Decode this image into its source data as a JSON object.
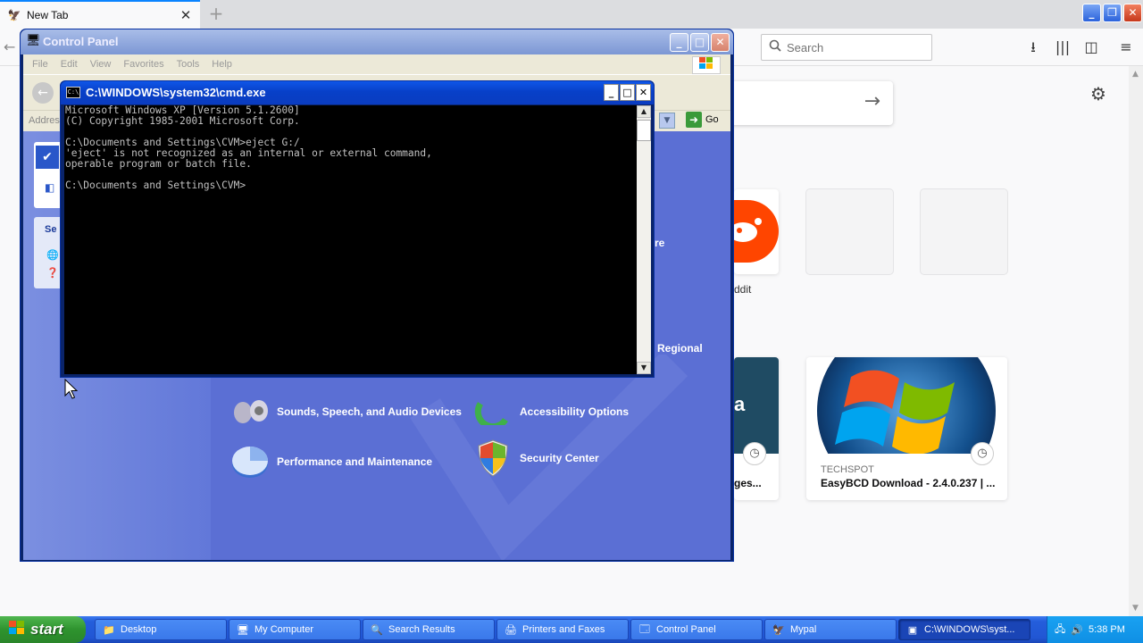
{
  "firefox": {
    "tab_title": "New Tab",
    "search_placeholder": "Search",
    "tile_labels": [
      "ddit"
    ],
    "highlights": [
      {
        "source": "",
        "title": "ges..."
      },
      {
        "source": "TECHSPOT",
        "title": "EasyBCD Download - 2.4.0.237 | ..."
      }
    ]
  },
  "control_panel": {
    "title": "Control Panel",
    "menu": [
      "File",
      "Edit",
      "View",
      "Favorites",
      "Tools",
      "Help"
    ],
    "address_label": "Addres",
    "go_label": "Go",
    "see_also_label": "Se",
    "categories": {
      "sounds": "Sounds, Speech, and Audio Devices",
      "accessibility": "Accessibility Options",
      "performance": "Performance and Maintenance",
      "security": "Security Center",
      "partial_1": "re",
      "partial_2": "Regional"
    }
  },
  "cmd": {
    "title": "C:\\WINDOWS\\system32\\cmd.exe",
    "lines": [
      "Microsoft Windows XP [Version 5.1.2600]",
      "(C) Copyright 1985-2001 Microsoft Corp.",
      "",
      "C:\\Documents and Settings\\CVM>eject G:/",
      "'eject' is not recognized as an internal or external command,",
      "operable program or batch file.",
      "",
      "C:\\Documents and Settings\\CVM>"
    ]
  },
  "taskbar": {
    "start_label": "start",
    "items": [
      {
        "label": "Desktop",
        "icon": "folder-icon"
      },
      {
        "label": "My Computer",
        "icon": "computer-icon"
      },
      {
        "label": "Search Results",
        "icon": "search-icon"
      },
      {
        "label": "Printers and Faxes",
        "icon": "printer-icon"
      },
      {
        "label": "Control Panel",
        "icon": "control-panel-icon"
      },
      {
        "label": "Mypal",
        "icon": "mypal-icon"
      },
      {
        "label": "C:\\WINDOWS\\syst...",
        "icon": "cmd-icon"
      }
    ],
    "clock": "5:38 PM"
  }
}
